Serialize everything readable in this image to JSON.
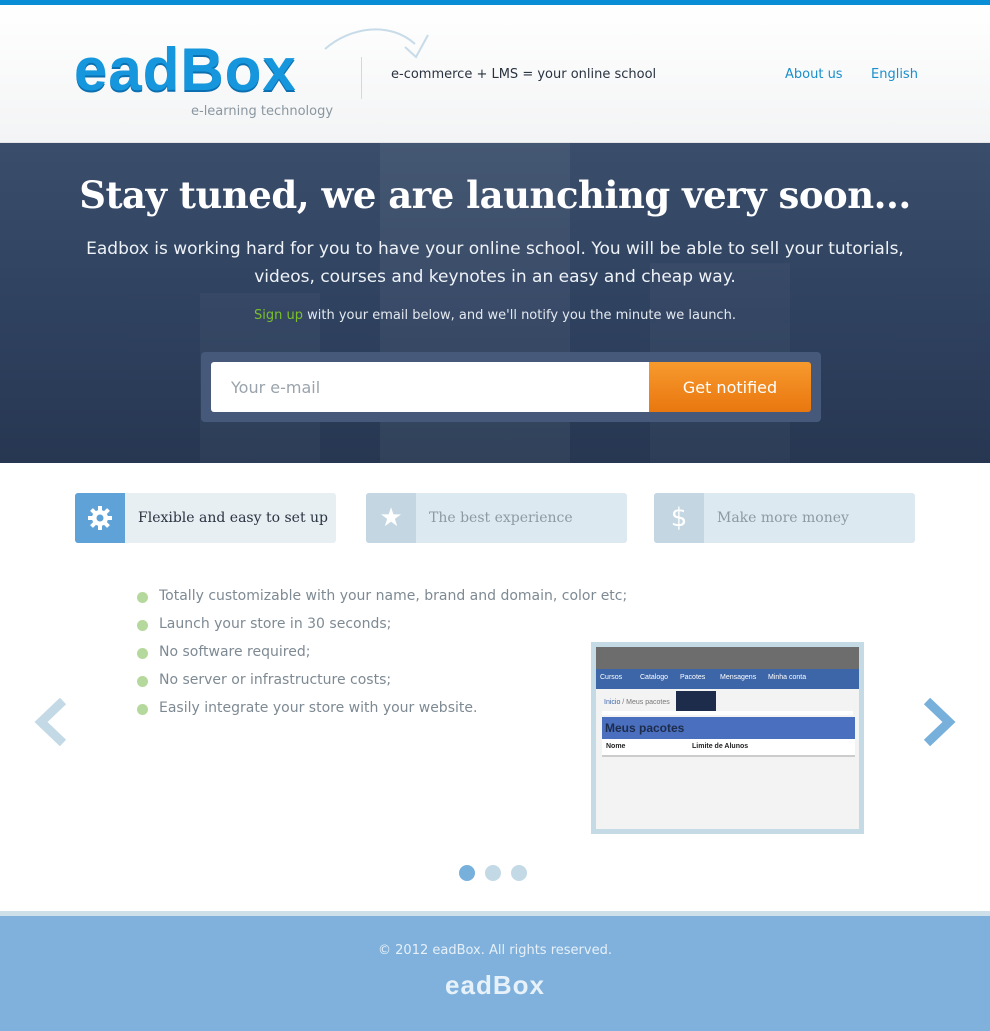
{
  "header": {
    "logo": "eadBox",
    "logo_subtitle": "e-learning technology",
    "tagline": "e-commerce + LMS = your online school",
    "nav": {
      "about": "About us",
      "language": "English"
    }
  },
  "hero": {
    "title": "Stay tuned, we are launching very soon...",
    "description": "Eadbox is working hard for you to have your online school. You will be able to sell your tutorials, videos, courses and keynotes in an easy and cheap way.",
    "signup_link": "Sign up",
    "signup_text": " with your email below, and we'll notify you the minute we launch.",
    "email_placeholder": "Your e-mail",
    "button_label": "Get notified"
  },
  "tabs": [
    {
      "label": "Flexible and easy to set up",
      "icon": "gear-icon",
      "active": true
    },
    {
      "label": "The best experience",
      "icon": "star-icon",
      "active": false
    },
    {
      "label": "Make more money",
      "icon": "dollar-icon",
      "active": false
    }
  ],
  "features": [
    "Totally customizable with your name, brand and domain, color etc;",
    "Launch your store in 30 seconds;",
    "No software required;",
    "No server or infrastructure costs;",
    "Easily integrate your store with your website."
  ],
  "screenshot": {
    "nav_items": [
      "Cursos",
      "Catalogo",
      "Pacotes",
      "Mensagens",
      "Minha conta"
    ],
    "breadcrumb_home": "Inicio",
    "breadcrumb_current": " / Meus pacotes",
    "heading": "Meus pacotes",
    "columns": [
      "Nome",
      "Limite de Alunos"
    ]
  },
  "carousel": {
    "slide_count": 3,
    "active_slide": 1
  },
  "footer": {
    "copyright": "© 2012 eadBox. All rights reserved.",
    "logo": "eadBox"
  },
  "colors": {
    "accent": "#0a8fd6",
    "hero_bg": "#2f4260",
    "button": "#f0861f",
    "signup_link": "#79c02a",
    "footer_bg": "#7fb1dc"
  }
}
